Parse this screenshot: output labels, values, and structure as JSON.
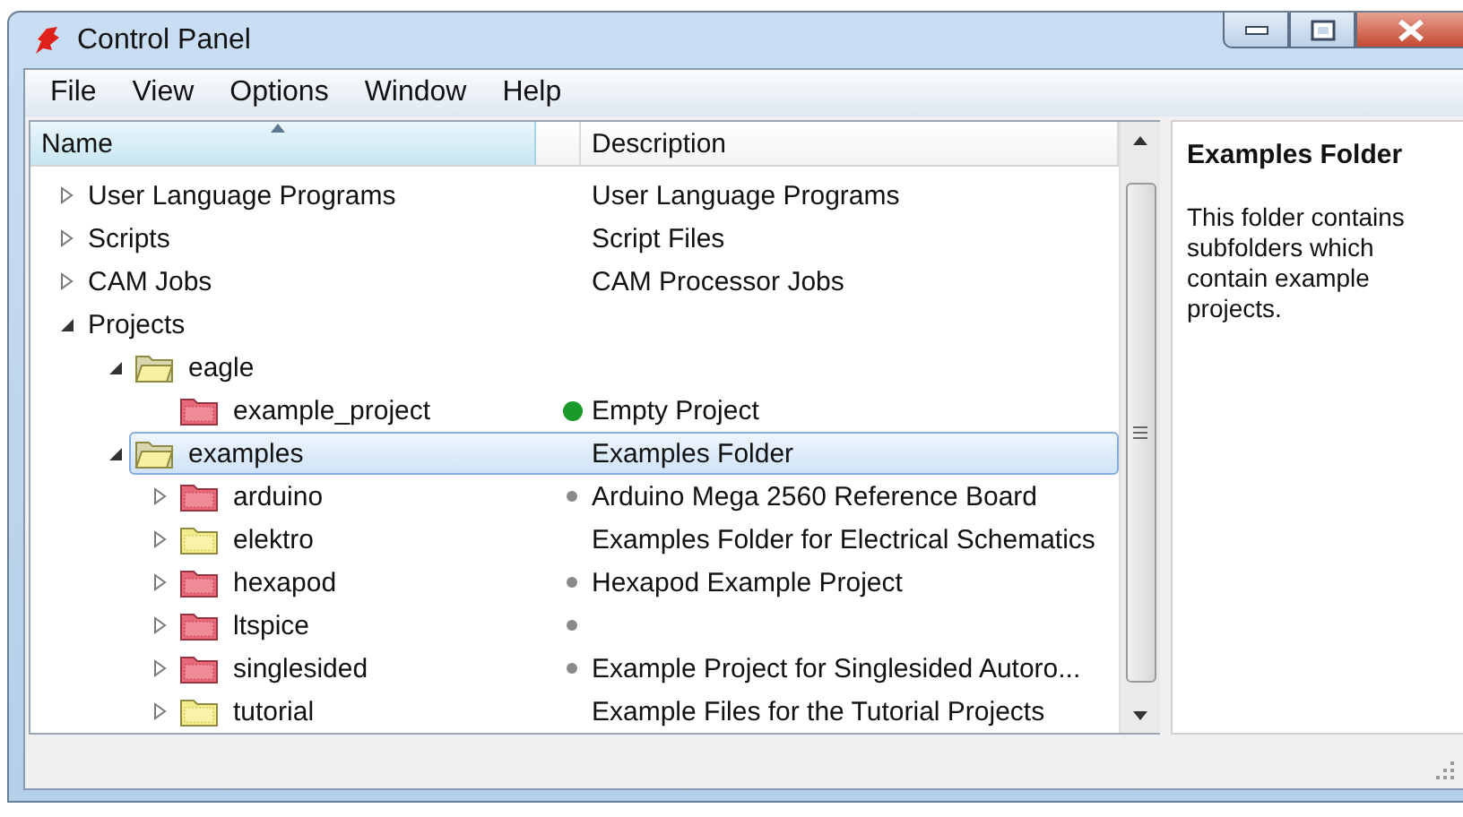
{
  "window": {
    "title": "Control Panel"
  },
  "menu": [
    "File",
    "View",
    "Options",
    "Window",
    "Help"
  ],
  "columns": [
    {
      "label": "Name",
      "sorted": true
    },
    {
      "label": "Description",
      "sorted": false
    }
  ],
  "tree": [
    {
      "name": "User Language Programs",
      "description": "User Language Programs",
      "expanded": false,
      "selected": false
    },
    {
      "name": "Scripts",
      "description": "Script Files",
      "expanded": false,
      "selected": false
    },
    {
      "name": "CAM Jobs",
      "description": "CAM Processor Jobs",
      "expanded": false,
      "selected": false
    },
    {
      "name": "Projects",
      "expanded": true,
      "selected": false,
      "children": [
        {
          "name": "eagle",
          "kind": "folder",
          "expanded": true,
          "selected": false,
          "children": [
            {
              "name": "example_project",
              "description": "Empty Project",
              "kind": "project",
              "color": "#1a9a2a",
              "selected": false
            }
          ]
        },
        {
          "name": "examples",
          "description": "Examples Folder",
          "kind": "folder",
          "expanded": true,
          "selected": true,
          "children": [
            {
              "name": "arduino",
              "description": "Arduino Mega 2560 Reference Board",
              "kind": "project",
              "color": "#8a8a8a",
              "expanded": false,
              "selected": false
            },
            {
              "name": "elektro",
              "description": "Examples Folder for Electrical Schematics",
              "kind": "folder",
              "expanded": false,
              "selected": false
            },
            {
              "name": "hexapod",
              "description": "Hexapod Example Project",
              "kind": "project",
              "color": "#8a8a8a",
              "expanded": false,
              "selected": false
            },
            {
              "name": "ltspice",
              "kind": "project",
              "color": "#8a8a8a",
              "expanded": false,
              "selected": false
            },
            {
              "name": "singlesided",
              "description": "Example Project for Singlesided Autoro...",
              "kind": "project",
              "color": "#8a8a8a",
              "expanded": false,
              "selected": false
            },
            {
              "name": "tutorial",
              "description": "Example Files for the Tutorial Projects",
              "kind": "folder",
              "expanded": false,
              "selected": false
            }
          ]
        }
      ]
    }
  ],
  "info": {
    "title": "Examples Folder",
    "text": "This folder contains subfolders which contain example projects."
  }
}
